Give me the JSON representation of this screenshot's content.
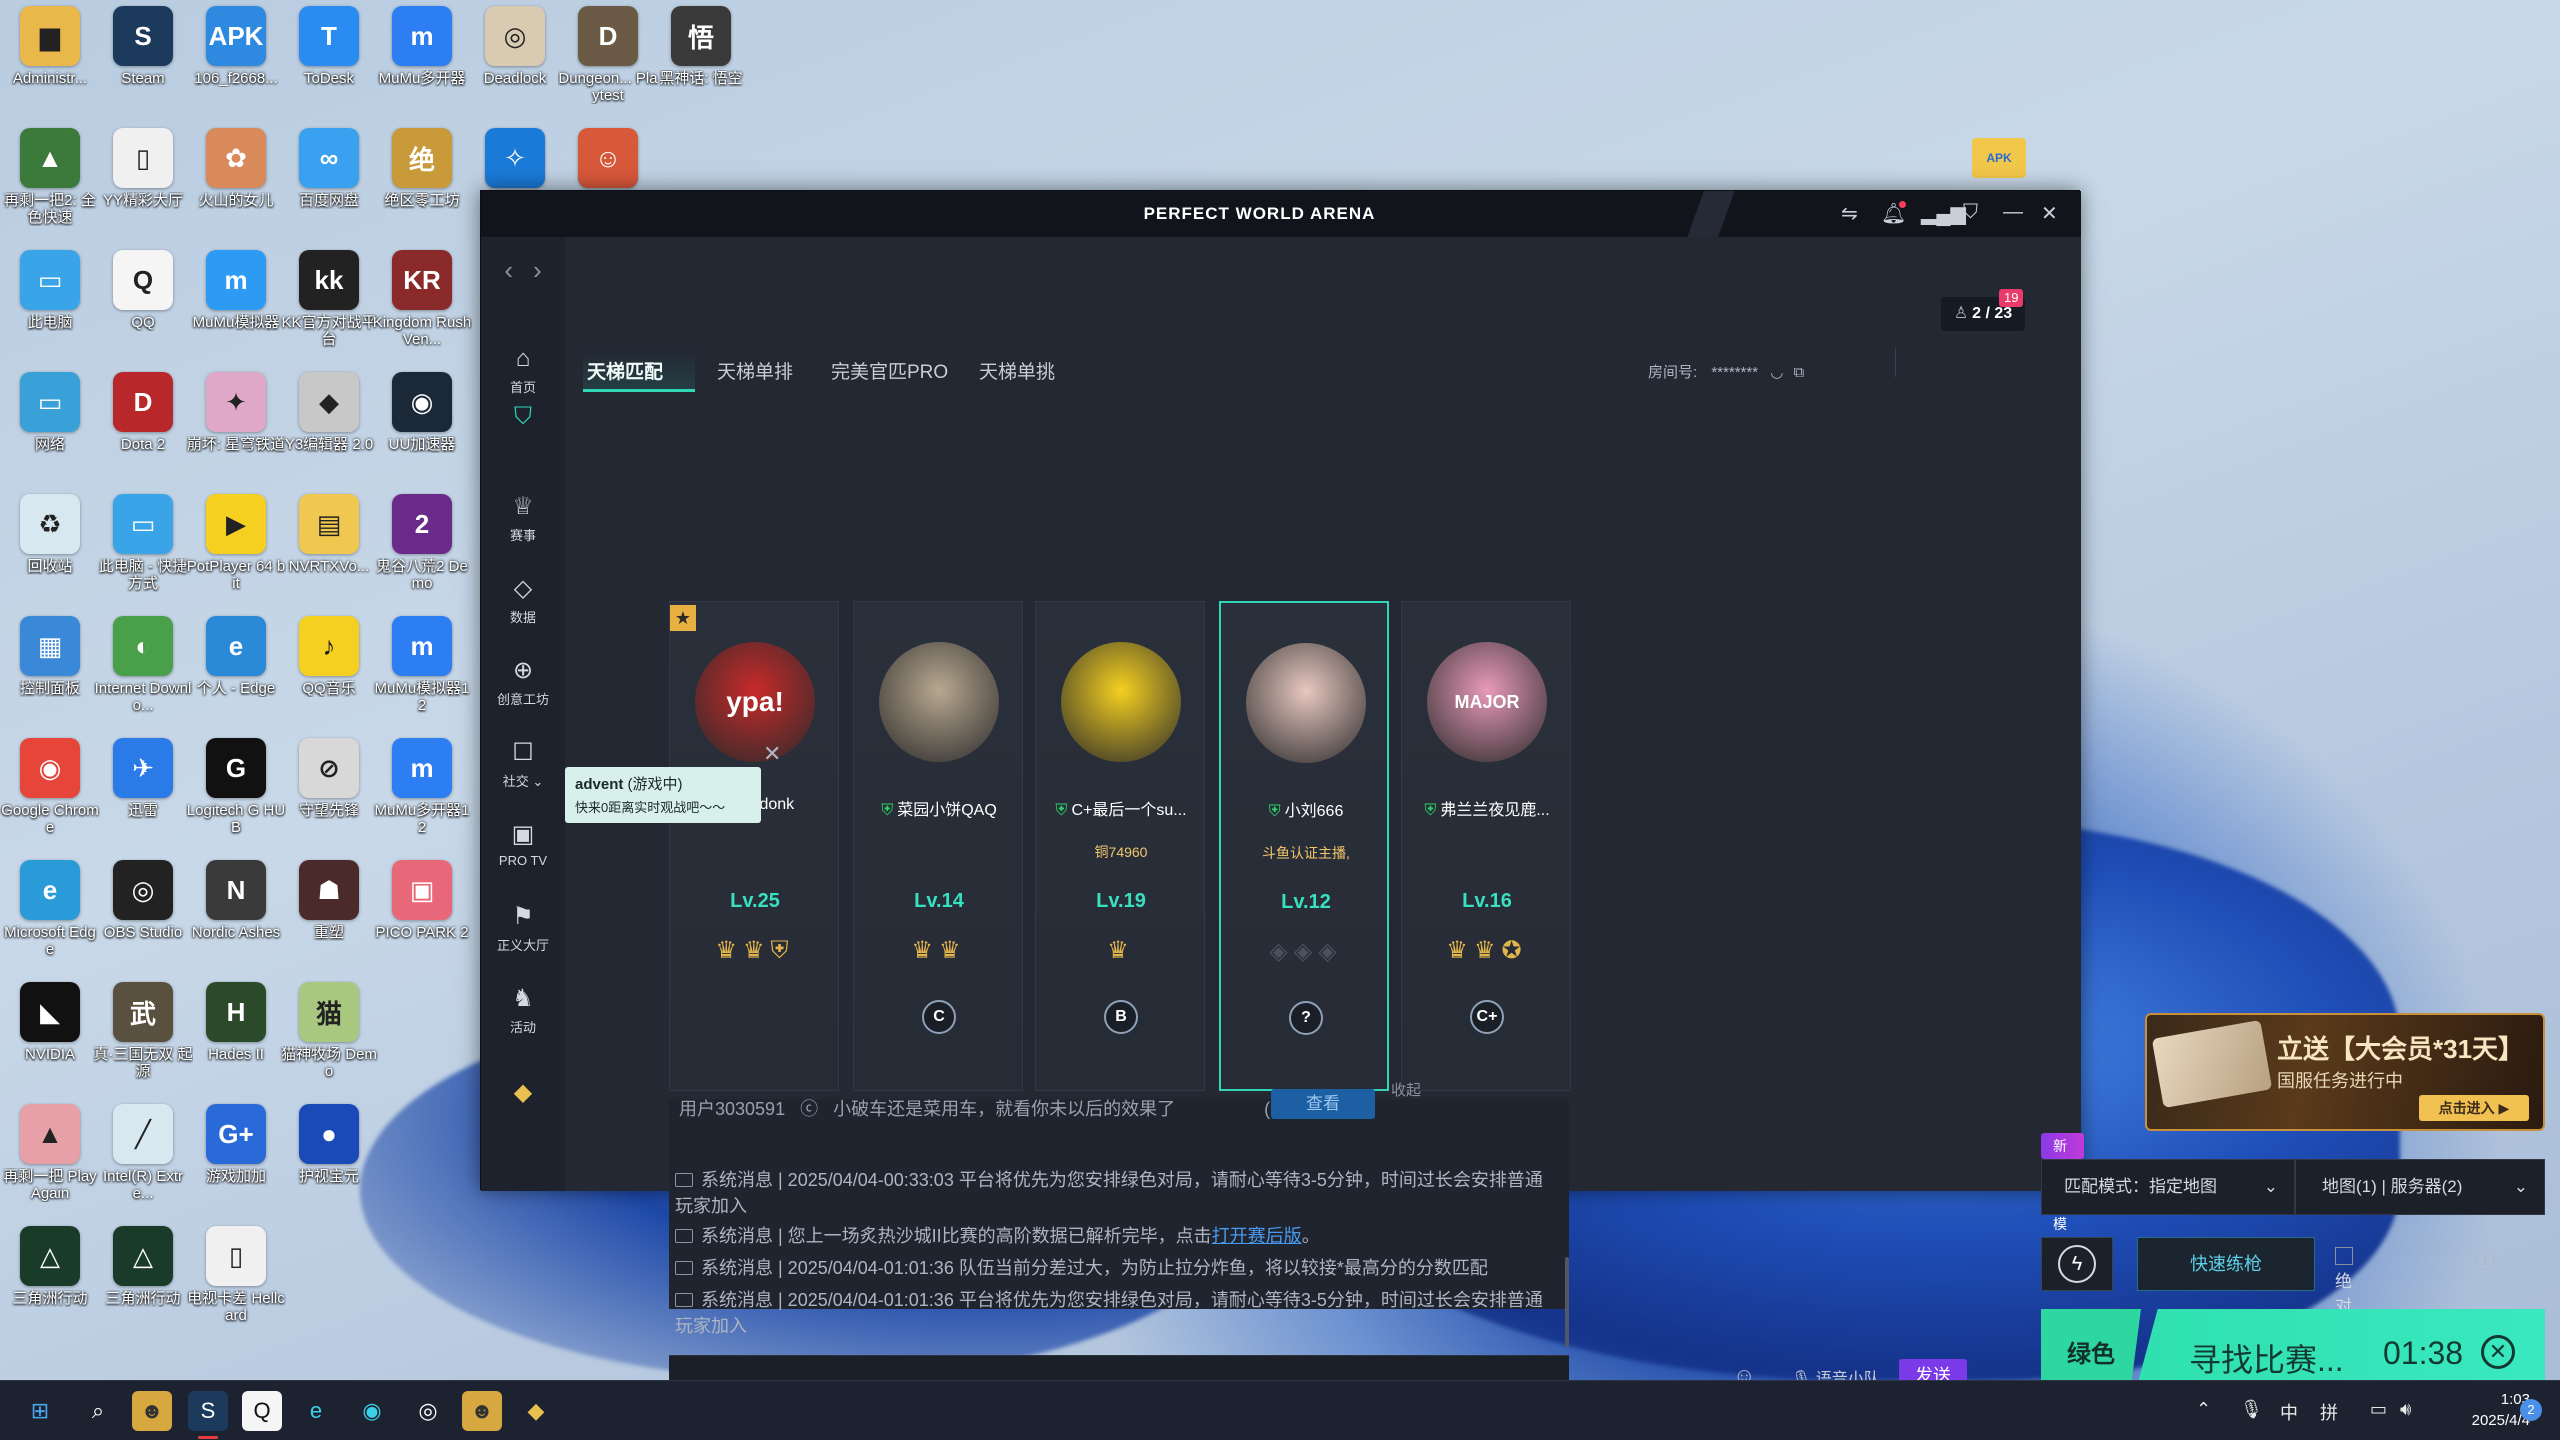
{
  "desktop": {
    "icons": [
      {
        "label": "Administr...",
        "glyph": "▆",
        "color": "#e8b94a"
      },
      {
        "label": "Steam",
        "glyph": "S",
        "color": "#1b3a5c"
      },
      {
        "label": "106_f2668...",
        "glyph": "APK",
        "color": "#2d8ae0"
      },
      {
        "label": "ToDesk",
        "glyph": "T",
        "color": "#2a8cf0"
      },
      {
        "label": "MuMu多开器",
        "glyph": "m",
        "color": "#2d7ef3"
      },
      {
        "label": "Deadlock",
        "glyph": "◎",
        "color": "#d8cbb2"
      },
      {
        "label": "Dungeon... Playtest",
        "glyph": "D",
        "color": "#6b5a45"
      },
      {
        "label": "黑神话: 悟空",
        "glyph": "悟",
        "color": "#3a3a3a"
      },
      {
        "label": "再剩一把2: 全色快速",
        "glyph": "▲",
        "color": "#3b7a3b"
      },
      {
        "label": "YY精彩大厅",
        "glyph": "▯",
        "color": "#f0f0f0"
      },
      {
        "label": "火山的女儿",
        "glyph": "✿",
        "color": "#d98a5a"
      },
      {
        "label": "百度网盘",
        "glyph": "∞",
        "color": "#3aa0f0"
      },
      {
        "label": "绝区零工坊",
        "glyph": "绝",
        "color": "#c89a3a"
      },
      {
        "label": "",
        "glyph": "✧",
        "color": "#1a7ad8"
      },
      {
        "label": "",
        "glyph": "☺",
        "color": "#d8583a"
      },
      {
        "label": "此电脑",
        "glyph": "▭",
        "color": "#39a5e8"
      },
      {
        "label": "QQ",
        "glyph": "Q",
        "color": "#f5f5f5"
      },
      {
        "label": "MuMu模拟器",
        "glyph": "m",
        "color": "#2d9af3"
      },
      {
        "label": "KK官方对战平台",
        "glyph": "kk",
        "color": "#222"
      },
      {
        "label": "Kingdom Rush Ven...",
        "glyph": "KR",
        "color": "#8a2a2a"
      },
      {
        "label": "网络",
        "glyph": "▭",
        "color": "#3aa0d8"
      },
      {
        "label": "Dota 2",
        "glyph": "D",
        "color": "#b8282a"
      },
      {
        "label": "崩坏: 星穹铁道",
        "glyph": "✦",
        "color": "#e0a8c8"
      },
      {
        "label": "Y3编辑器 2.0",
        "glyph": "◆",
        "color": "#c8c8c8"
      },
      {
        "label": "UU加速器",
        "glyph": "◉",
        "color": "#1a2838"
      },
      {
        "label": "回收站",
        "glyph": "♻",
        "color": "#d8e8f0"
      },
      {
        "label": "此电脑 - 快捷方式",
        "glyph": "▭",
        "color": "#39a5e8"
      },
      {
        "label": "PotPlayer 64 bit",
        "glyph": "▶",
        "color": "#f5d020"
      },
      {
        "label": "NVRTXVo...",
        "glyph": "▤",
        "color": "#f0c850"
      },
      {
        "label": "鬼谷八荒2 Demo",
        "glyph": "2",
        "color": "#6a2a8a"
      },
      {
        "label": "控制面板",
        "glyph": "▦",
        "color": "#3a88d8"
      },
      {
        "label": "Internet Downlo...",
        "glyph": "◐",
        "color": "#4aa04a"
      },
      {
        "label": "个人 - Edge",
        "glyph": "e",
        "color": "#2a8ad8"
      },
      {
        "label": "QQ音乐",
        "glyph": "♪",
        "color": "#f5d020"
      },
      {
        "label": "MuMu模拟器12",
        "glyph": "m",
        "color": "#2d7ef3"
      },
      {
        "label": "Google Chrome",
        "glyph": "◉",
        "color": "#e8453a"
      },
      {
        "label": "迅雷",
        "glyph": "✈",
        "color": "#2a7ae8"
      },
      {
        "label": "Logitech G HUB",
        "glyph": "G",
        "color": "#111"
      },
      {
        "label": "守望先锋",
        "glyph": "⊘",
        "color": "#d8d8d8"
      },
      {
        "label": "MuMu多开器12",
        "glyph": "m",
        "color": "#2d7ef3"
      },
      {
        "label": "Microsoft Edge",
        "glyph": "e",
        "color": "#2a9ad8"
      },
      {
        "label": "OBS Studio",
        "glyph": "◎",
        "color": "#222"
      },
      {
        "label": "Nordic Ashes",
        "glyph": "N",
        "color": "#3a3a3a"
      },
      {
        "label": "重塑",
        "glyph": "☗",
        "color": "#4a2a2a"
      },
      {
        "label": "PICO PARK 2",
        "glyph": "▣",
        "color": "#e8687a"
      },
      {
        "label": "NVIDIA",
        "glyph": "◣",
        "color": "#111"
      },
      {
        "label": "真·三国无双 起源",
        "glyph": "武",
        "color": "#5a5040"
      },
      {
        "label": "Hades II",
        "glyph": "H",
        "color": "#2a4a2a"
      },
      {
        "label": "猫神牧场 Demo",
        "glyph": "猫",
        "color": "#a8c880"
      },
      {
        "label": "",
        "glyph": "",
        "color": "transparent"
      },
      {
        "label": "再剩一把 PlayAgain",
        "glyph": "▲",
        "color": "#e8a0a8"
      },
      {
        "label": "Intel(R) Extre...",
        "glyph": "╱",
        "color": "#d8e8f0"
      },
      {
        "label": "游戏加加",
        "glyph": "G+",
        "color": "#2a6ad8"
      },
      {
        "label": "护视宝元",
        "glyph": "●",
        "color": "#1a4ab8"
      },
      {
        "label": "",
        "glyph": "",
        "color": "transparent"
      },
      {
        "label": "三角洲行动",
        "glyph": "△",
        "color": "#1a3a2a"
      },
      {
        "label": "三角洲行动",
        "glyph": "△",
        "color": "#1a3a2a"
      },
      {
        "label": "电视卡差 Hellcard",
        "glyph": "▯",
        "color": "#f0f0f0"
      }
    ],
    "folder_glyph": "APK"
  },
  "app": {
    "title": "PERFECT WORLD ARENA",
    "nav_back": "‹",
    "nav_fwd": "›",
    "player_count": "2 / 23",
    "notif_count": "19",
    "sidebar": [
      {
        "icon": "⌂",
        "label": "首页"
      },
      {
        "icon": "⛉",
        "label": ""
      },
      {
        "icon": "♕",
        "label": "赛事"
      },
      {
        "icon": "◇",
        "label": "数据"
      },
      {
        "icon": "⊕",
        "label": "创意工坊"
      },
      {
        "icon": "☐",
        "label": "社交 ⌄"
      },
      {
        "icon": "▣",
        "label": "PRO TV"
      },
      {
        "icon": "⚑",
        "label": "正义大厅"
      },
      {
        "icon": "♞",
        "label": "活动"
      },
      {
        "icon": "◆",
        "label": ""
      }
    ],
    "tabs": [
      "天梯匹配",
      "天梯单排",
      "完美官匹PRO",
      "天梯单挑"
    ],
    "room": {
      "label": "房间号:",
      "value": "********"
    },
    "players": [
      {
        "name": "VG.donk",
        "sub": "",
        "level": "Lv.25",
        "badges": "♛♛⛨",
        "rank": "",
        "avatar": "ypa!",
        "avcolor": "#c82a2a"
      },
      {
        "name": "菜园小饼QAQ",
        "sub": "",
        "level": "Lv.14",
        "badges": "♛♛",
        "rank": "C",
        "avatar": "",
        "avcolor": "#b8a890"
      },
      {
        "name": "C+最后一个su...",
        "sub": "铜74960",
        "level": "Lv.19",
        "badges": "♛",
        "rank": "B",
        "avatar": "",
        "avcolor": "#f5d020"
      },
      {
        "name": "小刘666",
        "sub": "斗鱼认证主播,",
        "level": "Lv.12",
        "badges": "◈◈◈",
        "rank": "?",
        "avatar": "",
        "avcolor": "#e8c8c0"
      },
      {
        "name": "弗兰兰夜见鹿...",
        "sub": "",
        "level": "Lv.16",
        "badges": "♛♛✪",
        "rank": "C+",
        "avatar": "MAJOR",
        "avcolor": "#e89ab8"
      }
    ],
    "tooltip": {
      "title": "advent",
      "status": "(游戏中)",
      "body": "快来0距离实时观战吧～～"
    },
    "chat_hidden_row": {
      "user": "用户3030591",
      "text": "小破车还是菜用车，就看你未以后的效果了",
      "count": "(1/5)",
      "btn": "查看",
      "collapse": "收起"
    },
    "messages": [
      {
        "prefix": "系统消息 | 2025/04/04-00:33:03 平台将优先为您安排绿色对局，请耐心等待3-5分钟，时间过长会安排普通玩家加入",
        "link": ""
      },
      {
        "prefix": "系统消息 | 您上一场炙热沙城II比赛的高阶数据已解析完毕，点击",
        "link": "打开赛后版"
      },
      {
        "prefix": "系统消息 | 2025/04/04-01:01:36 队伍当前分差过大，为防止拉分炸鱼，将以较接*最高分的分数匹配",
        "link": ""
      },
      {
        "prefix": "系统消息 | 2025/04/04-01:01:36 平台将优先为您安排绿色对局，请耐心等待3-5分钟，时间过长会安排普通玩家加入",
        "link": ""
      }
    ],
    "voice_label": "语音小队",
    "send_label": "发送",
    "promo": {
      "line1": "立送【大会员*31天】",
      "line2": "国服任务进行中",
      "btn": "点击进入 ▶"
    },
    "bp_badge": "新增BP模式",
    "match_mode": "匹配模式：指定地图",
    "map_select": "地图(1) | 服务器(2)",
    "quick_label": "快速练枪",
    "green_only": "绝对绿色",
    "green_tag": "绿色",
    "search_label": "寻找比赛...",
    "timer": "01:38"
  },
  "taskbar": {
    "clock_time": "1:03",
    "clock_date": "2025/4/4",
    "ime1": "中",
    "ime2": "拼",
    "notif": "2"
  }
}
